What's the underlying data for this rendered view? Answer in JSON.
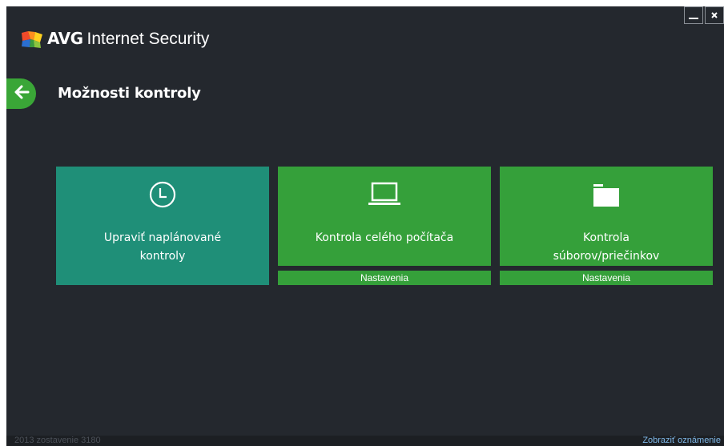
{
  "app": {
    "brand": "AVG",
    "product": "Internet Security"
  },
  "window_controls": {
    "minimize_icon": "minimize-icon",
    "close_icon": "close-icon"
  },
  "header": {
    "back_icon": "arrow-left-icon",
    "title": "Možnosti kontroly"
  },
  "tiles": [
    {
      "label": "Upraviť naplánované\nkontroly",
      "icon": "clock-icon",
      "color": "#1f8f78"
    },
    {
      "label": "Kontrola celého počítača",
      "icon": "laptop-icon",
      "color": "#35a03a",
      "settings_label": "Nastavenia"
    },
    {
      "label": "Kontrola\nsúborov/priečinkov",
      "icon": "folder-icon",
      "color": "#35a03a",
      "settings_label": "Nastavenia"
    }
  ],
  "footer": {
    "build": "2013  zostavenie 3180",
    "notifications": "Zobraziť oznámenie"
  },
  "colors": {
    "background": "#24282e",
    "accent_green": "#35a03a",
    "teal": "#1f8f78",
    "back_button": "#3aa637"
  }
}
